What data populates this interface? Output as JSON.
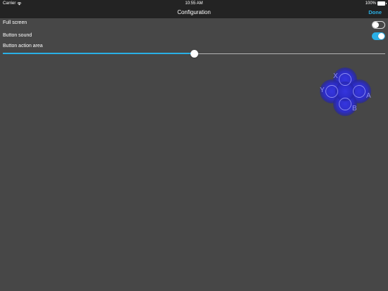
{
  "status_bar": {
    "carrier": "Carrier",
    "time": "10:55 AM",
    "battery_percent": "100%",
    "battery_level": 1.0,
    "icons": [
      "wifi-icon",
      "battery-icon"
    ]
  },
  "nav": {
    "title": "Configuration",
    "done_label": "Done",
    "accent_color": "#2ab0e6"
  },
  "settings": {
    "full_screen": {
      "label": "Full screen",
      "enabled": false
    },
    "button_sound": {
      "label": "Button sound",
      "enabled": true
    },
    "button_action_area": {
      "label": "Button action area",
      "value": 0.5
    }
  },
  "gamepad": {
    "buttons": [
      "X",
      "Y",
      "A",
      "B"
    ],
    "color": "#2f2fd6"
  },
  "colors": {
    "background": "#474747",
    "bar": "#232323"
  }
}
